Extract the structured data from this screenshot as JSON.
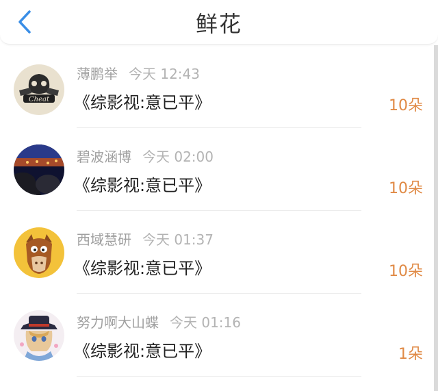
{
  "header": {
    "title": "鲜花",
    "back_icon": "chevron-left-icon",
    "accent_color": "#3a8ee6"
  },
  "items": [
    {
      "name": "薄鹏举",
      "time": "今天 12:43",
      "book": "《综影视:意已平》",
      "count": "10朵"
    },
    {
      "name": "碧波涵博",
      "time": "今天 02:00",
      "book": "《综影视:意已平》",
      "count": "10朵"
    },
    {
      "name": "西域慧研",
      "time": "今天 01:37",
      "book": "《综影视:意已平》",
      "count": "10朵"
    },
    {
      "name": "努力啊大山蝶",
      "time": "今天 01:16",
      "book": "《综影视:意已平》",
      "count": "1朵"
    }
  ],
  "colors": {
    "count": "#e08a45",
    "name": "#a0a0a0",
    "book": "#222222"
  }
}
